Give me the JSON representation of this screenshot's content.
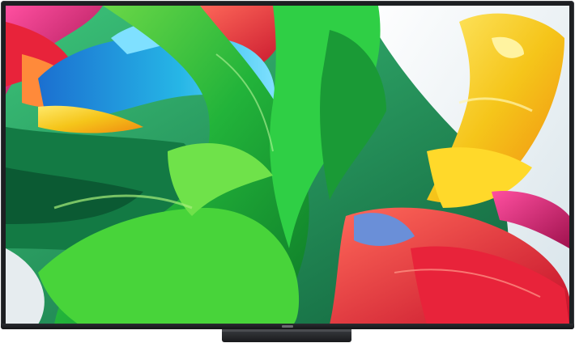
{
  "product": {
    "icon": "tv-icon",
    "screen_content": "paint-swirl-wallpaper"
  },
  "colors": {
    "bezel": "#1d1f22",
    "green": "#22b33a",
    "blue": "#1fa9d8",
    "red": "#e8233a",
    "yellow": "#f5c51a",
    "magenta": "#d61b6a"
  }
}
